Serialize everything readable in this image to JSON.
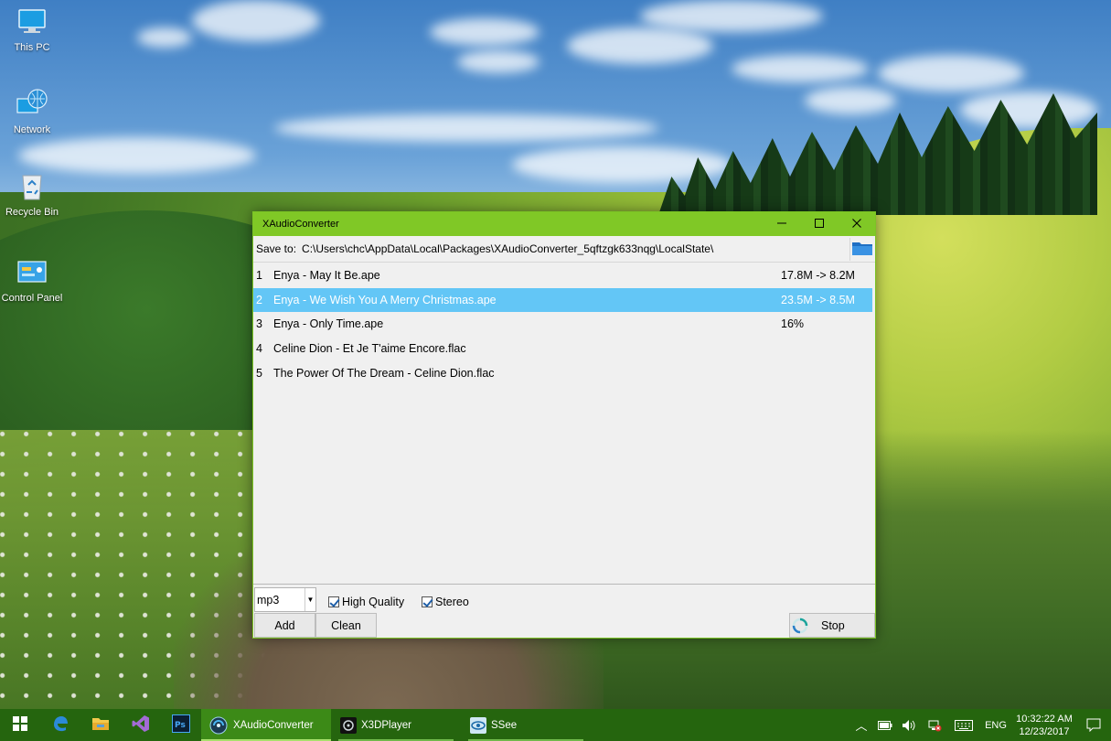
{
  "desktop": {
    "icons": [
      {
        "label": "This PC"
      },
      {
        "label": "Network"
      },
      {
        "label": "Recycle Bin"
      },
      {
        "label": "Control Panel"
      }
    ]
  },
  "window": {
    "title": "XAudioConverter",
    "save_to_label": "Save to:",
    "save_path": "C:\\Users\\chc\\AppData\\Local\\Packages\\XAudioConverter_5qftzgk633nqg\\LocalState\\",
    "files": [
      {
        "num": "1",
        "name": "Enya - May It Be.ape",
        "status": "17.8M -> 8.2M"
      },
      {
        "num": "2",
        "name": "Enya - We Wish You A Merry Christmas.ape",
        "status": "23.5M -> 8.5M",
        "selected": true
      },
      {
        "num": "3",
        "name": "Enya - Only Time.ape",
        "status": "16%"
      },
      {
        "num": "4",
        "name": "Celine Dion - Et Je T'aime Encore.flac",
        "status": ""
      },
      {
        "num": "5",
        "name": "The Power Of The Dream - Celine Dion.flac",
        "status": ""
      }
    ],
    "format_value": "mp3",
    "high_quality_label": "High Quality",
    "high_quality_checked": true,
    "stereo_label": "Stereo",
    "stereo_checked": true,
    "add_label": "Add",
    "clean_label": "Clean",
    "stop_label": "Stop"
  },
  "taskbar": {
    "apps": [
      {
        "label": "XAudioConverter",
        "active": true
      },
      {
        "label": "X3DPlayer"
      },
      {
        "label": "SSee"
      }
    ],
    "language": "ENG",
    "time": "10:32:22 AM",
    "date": "12/23/2017"
  },
  "colors": {
    "accent": "#80c826",
    "selection": "#63c6f6",
    "taskbar": "#25650e"
  }
}
